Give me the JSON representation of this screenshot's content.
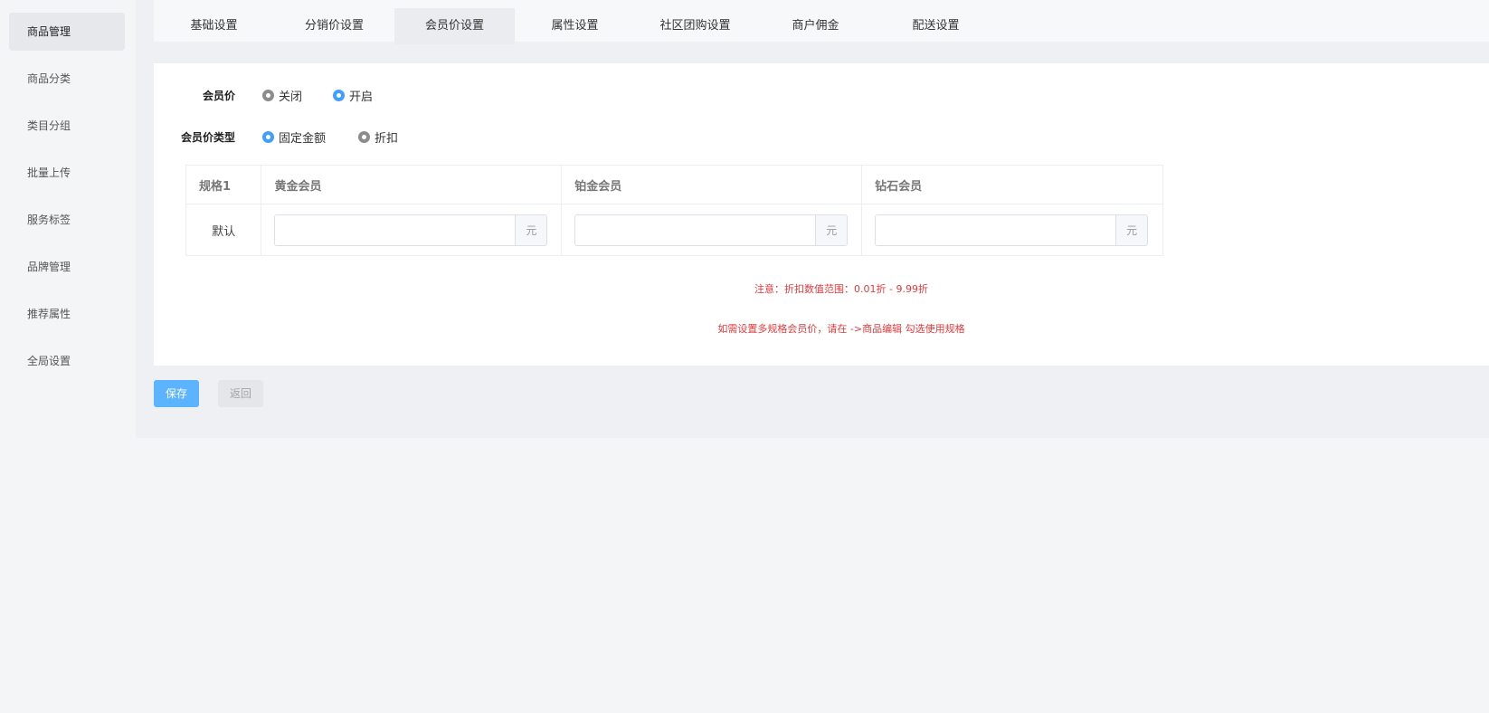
{
  "sidebar": {
    "items": [
      {
        "label": "商品管理",
        "active": true
      },
      {
        "label": "商品分类"
      },
      {
        "label": "类目分组"
      },
      {
        "label": "批量上传"
      },
      {
        "label": "服务标签"
      },
      {
        "label": "品牌管理"
      },
      {
        "label": "推荐属性"
      },
      {
        "label": "全局设置"
      }
    ]
  },
  "tabs": [
    {
      "label": "基础设置"
    },
    {
      "label": "分销价设置"
    },
    {
      "label": "会员价设置",
      "active": true
    },
    {
      "label": "属性设置"
    },
    {
      "label": "社区团购设置"
    },
    {
      "label": "商户佣金"
    },
    {
      "label": "配送设置"
    }
  ],
  "form": {
    "member_price": {
      "label": "会员价",
      "options": [
        {
          "label": "关闭",
          "checked": false
        },
        {
          "label": "开启",
          "checked": true
        }
      ]
    },
    "member_price_type": {
      "label": "会员价类型",
      "options": [
        {
          "label": "固定金额",
          "checked": true
        },
        {
          "label": "折扣",
          "checked": false
        }
      ]
    },
    "table": {
      "headers": [
        "规格1",
        "黄金会员",
        "铂金会员",
        "钻石会员"
      ],
      "rows": [
        {
          "spec": "默认",
          "values": [
            "",
            "",
            ""
          ]
        }
      ],
      "unit": "元"
    },
    "notice_discount": "注意：折扣数值范围：0.01折 - 9.99折",
    "notice_multi_spec": "如需设置多规格会员价，请在 ->商品编辑 勾选使用规格"
  },
  "buttons": {
    "save": "保存",
    "back": "返回"
  },
  "colors": {
    "accent": "#409eff",
    "save_button": "#5cb3ff",
    "notice": "#e4393c"
  }
}
